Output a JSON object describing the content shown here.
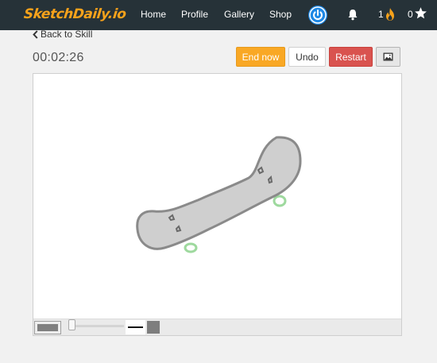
{
  "nav": {
    "logo": "SketchDaily.io",
    "links": [
      "Home",
      "Profile",
      "Gallery",
      "Shop"
    ],
    "flame_count": "1",
    "star_count": "0"
  },
  "back_link": "Back to Skill",
  "timer": "00:02:26",
  "buttons": {
    "end_now": "End now",
    "undo": "Undo",
    "restart": "Restart"
  },
  "colors": {
    "navbar": "#263238",
    "logo": "#f7a21b",
    "end_now": "#f9a825",
    "restart": "#d9534f",
    "sketch_fill": "#cfcfcf",
    "sketch_stroke": "#8a8a8a",
    "wheel": "#9ed99e"
  },
  "icons": [
    "power-icon",
    "bell-icon",
    "flame-icon",
    "star-icon",
    "chevron-left-icon",
    "image-icon"
  ],
  "sketch": {
    "subject": "skateboard",
    "brush_color": "#7e7e7e"
  }
}
